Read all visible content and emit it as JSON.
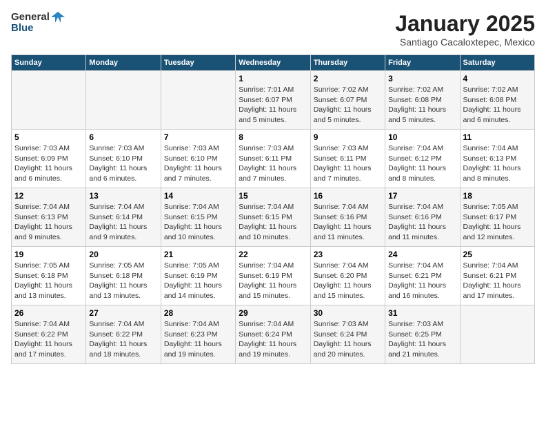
{
  "header": {
    "logo_general": "General",
    "logo_blue": "Blue",
    "month": "January 2025",
    "location": "Santiago Cacaloxtepec, Mexico"
  },
  "weekdays": [
    "Sunday",
    "Monday",
    "Tuesday",
    "Wednesday",
    "Thursday",
    "Friday",
    "Saturday"
  ],
  "weeks": [
    [
      {
        "day": "",
        "info": ""
      },
      {
        "day": "",
        "info": ""
      },
      {
        "day": "",
        "info": ""
      },
      {
        "day": "1",
        "info": "Sunrise: 7:01 AM\nSunset: 6:07 PM\nDaylight: 11 hours and 5 minutes."
      },
      {
        "day": "2",
        "info": "Sunrise: 7:02 AM\nSunset: 6:07 PM\nDaylight: 11 hours and 5 minutes."
      },
      {
        "day": "3",
        "info": "Sunrise: 7:02 AM\nSunset: 6:08 PM\nDaylight: 11 hours and 5 minutes."
      },
      {
        "day": "4",
        "info": "Sunrise: 7:02 AM\nSunset: 6:08 PM\nDaylight: 11 hours and 6 minutes."
      }
    ],
    [
      {
        "day": "5",
        "info": "Sunrise: 7:03 AM\nSunset: 6:09 PM\nDaylight: 11 hours and 6 minutes."
      },
      {
        "day": "6",
        "info": "Sunrise: 7:03 AM\nSunset: 6:10 PM\nDaylight: 11 hours and 6 minutes."
      },
      {
        "day": "7",
        "info": "Sunrise: 7:03 AM\nSunset: 6:10 PM\nDaylight: 11 hours and 7 minutes."
      },
      {
        "day": "8",
        "info": "Sunrise: 7:03 AM\nSunset: 6:11 PM\nDaylight: 11 hours and 7 minutes."
      },
      {
        "day": "9",
        "info": "Sunrise: 7:03 AM\nSunset: 6:11 PM\nDaylight: 11 hours and 7 minutes."
      },
      {
        "day": "10",
        "info": "Sunrise: 7:04 AM\nSunset: 6:12 PM\nDaylight: 11 hours and 8 minutes."
      },
      {
        "day": "11",
        "info": "Sunrise: 7:04 AM\nSunset: 6:13 PM\nDaylight: 11 hours and 8 minutes."
      }
    ],
    [
      {
        "day": "12",
        "info": "Sunrise: 7:04 AM\nSunset: 6:13 PM\nDaylight: 11 hours and 9 minutes."
      },
      {
        "day": "13",
        "info": "Sunrise: 7:04 AM\nSunset: 6:14 PM\nDaylight: 11 hours and 9 minutes."
      },
      {
        "day": "14",
        "info": "Sunrise: 7:04 AM\nSunset: 6:15 PM\nDaylight: 11 hours and 10 minutes."
      },
      {
        "day": "15",
        "info": "Sunrise: 7:04 AM\nSunset: 6:15 PM\nDaylight: 11 hours and 10 minutes."
      },
      {
        "day": "16",
        "info": "Sunrise: 7:04 AM\nSunset: 6:16 PM\nDaylight: 11 hours and 11 minutes."
      },
      {
        "day": "17",
        "info": "Sunrise: 7:04 AM\nSunset: 6:16 PM\nDaylight: 11 hours and 11 minutes."
      },
      {
        "day": "18",
        "info": "Sunrise: 7:05 AM\nSunset: 6:17 PM\nDaylight: 11 hours and 12 minutes."
      }
    ],
    [
      {
        "day": "19",
        "info": "Sunrise: 7:05 AM\nSunset: 6:18 PM\nDaylight: 11 hours and 13 minutes."
      },
      {
        "day": "20",
        "info": "Sunrise: 7:05 AM\nSunset: 6:18 PM\nDaylight: 11 hours and 13 minutes."
      },
      {
        "day": "21",
        "info": "Sunrise: 7:05 AM\nSunset: 6:19 PM\nDaylight: 11 hours and 14 minutes."
      },
      {
        "day": "22",
        "info": "Sunrise: 7:04 AM\nSunset: 6:19 PM\nDaylight: 11 hours and 15 minutes."
      },
      {
        "day": "23",
        "info": "Sunrise: 7:04 AM\nSunset: 6:20 PM\nDaylight: 11 hours and 15 minutes."
      },
      {
        "day": "24",
        "info": "Sunrise: 7:04 AM\nSunset: 6:21 PM\nDaylight: 11 hours and 16 minutes."
      },
      {
        "day": "25",
        "info": "Sunrise: 7:04 AM\nSunset: 6:21 PM\nDaylight: 11 hours and 17 minutes."
      }
    ],
    [
      {
        "day": "26",
        "info": "Sunrise: 7:04 AM\nSunset: 6:22 PM\nDaylight: 11 hours and 17 minutes."
      },
      {
        "day": "27",
        "info": "Sunrise: 7:04 AM\nSunset: 6:22 PM\nDaylight: 11 hours and 18 minutes."
      },
      {
        "day": "28",
        "info": "Sunrise: 7:04 AM\nSunset: 6:23 PM\nDaylight: 11 hours and 19 minutes."
      },
      {
        "day": "29",
        "info": "Sunrise: 7:04 AM\nSunset: 6:24 PM\nDaylight: 11 hours and 19 minutes."
      },
      {
        "day": "30",
        "info": "Sunrise: 7:03 AM\nSunset: 6:24 PM\nDaylight: 11 hours and 20 minutes."
      },
      {
        "day": "31",
        "info": "Sunrise: 7:03 AM\nSunset: 6:25 PM\nDaylight: 11 hours and 21 minutes."
      },
      {
        "day": "",
        "info": ""
      }
    ]
  ]
}
